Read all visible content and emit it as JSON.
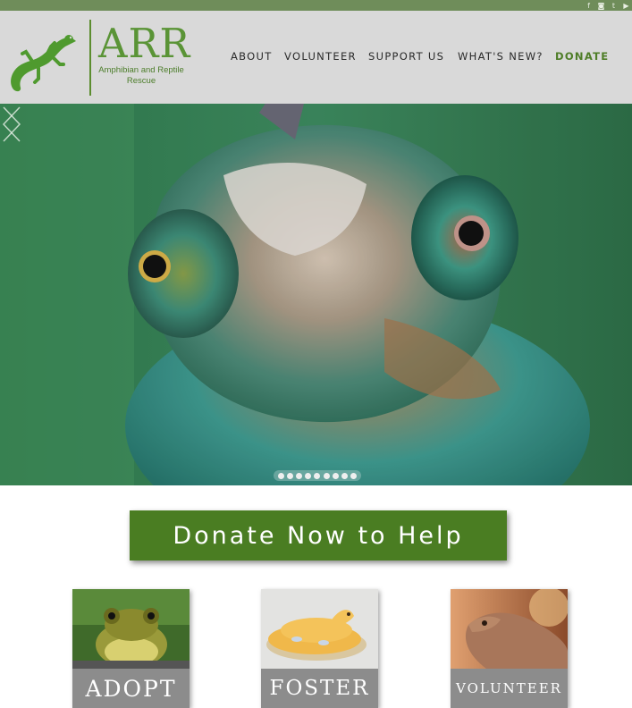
{
  "social": {
    "icons": [
      "facebook-icon",
      "instagram-icon",
      "twitter-icon",
      "youtube-icon"
    ],
    "glyphs": [
      "f",
      "◙",
      "t",
      "▶"
    ]
  },
  "brand": {
    "name": "ARR",
    "subtitle": "Amphibian and Reptile Rescue",
    "color": "#5a9436"
  },
  "nav": {
    "items": [
      {
        "label": "ABOUT"
      },
      {
        "label": "VOLUNTEER"
      },
      {
        "label": "SUPPORT US"
      },
      {
        "label": "WHAT'S NEW?"
      },
      {
        "label": "DONATE"
      }
    ],
    "accent": "#4e7d27"
  },
  "hero": {
    "prev_icon": "chevron-left-icon",
    "next_icon": "chevron-right-icon",
    "slide_count": 9
  },
  "cta": {
    "label": "Donate Now to Help",
    "color": "#4a7d22"
  },
  "cards": [
    {
      "label": "ADOPT"
    },
    {
      "label": "FOSTER"
    },
    {
      "label": "VOLUNTEER"
    }
  ]
}
